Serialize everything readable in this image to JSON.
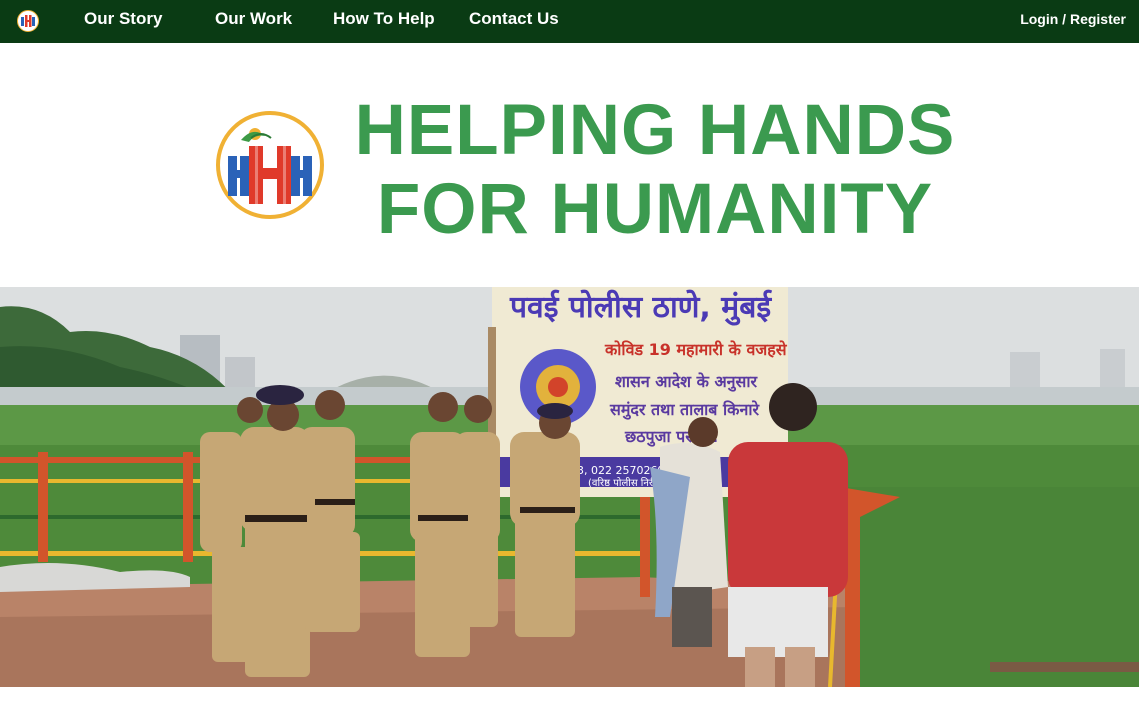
{
  "nav": {
    "logo_icon": "hhh-logo-icon",
    "links": [
      "Our Story",
      "Our Work",
      "How To Help",
      "Contact Us"
    ],
    "login_label": "Login",
    "separator": " / ",
    "register_label": "Register"
  },
  "hero": {
    "logo_icon": "hhh-emblem-icon",
    "logo_letters": "HHH",
    "title_line1": "HELPING HANDS",
    "title_line2": "FOR HUMANITY"
  },
  "photo": {
    "sign_heading": "पवई पोलीस ठाणे, मुंबई",
    "sign_line1": "कोविड 19 महामारी के वजहसे",
    "sign_line2": "शासन आदेश के अनुसार",
    "sign_line3": "समुंदर तथा तालाब किनारे",
    "sign_line4": "छठपुजा पर        है !",
    "sign_phone": "03, 022 25702690",
    "sign_footer": "(वरिष्ठ पोलीस निरी"
  },
  "colors": {
    "nav_bg": "#0a3b14",
    "title_green": "#3b9a4f",
    "logo_red": "#e03a2a",
    "logo_blue": "#2a62b8",
    "logo_ring": "#f0b134"
  }
}
